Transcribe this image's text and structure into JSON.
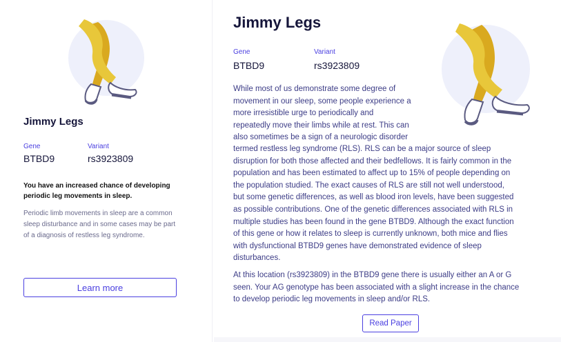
{
  "left_card": {
    "title": "Jimmy Legs",
    "gene_label": "Gene",
    "gene_value": "BTBD9",
    "variant_label": "Variant",
    "variant_value": "rs3923809",
    "result_text": "You have an increased chance of developing periodic leg movements in sleep.",
    "description": "Periodic limb movements in sleep are a common sleep disturbance and in some cases may be part of a diagnosis of restless leg syndrome.",
    "button_label": "Learn more"
  },
  "main": {
    "title": "Jimmy Legs",
    "gene_label": "Gene",
    "gene_value": "BTBD9",
    "variant_label": "Variant",
    "variant_value": "rs3923809",
    "paragraph1_lines": [
      "While most of us demonstrate some degree of",
      "movement in our sleep, some people experience a",
      "more irresistible urge to periodically and",
      "repeatedly move their limbs while at rest. This can",
      "also sometimes be a sign of a neurologic disorder",
      "termed restless leg syndrome (RLS). RLS can be a major source of sleep",
      "disruption for both those affected and their bedfellows. It is fairly common in the",
      "population and has been estimated to affect up to 15% of people depending on",
      "the population studied. The exact causes of RLS are still not well understood,",
      "but some genetic differences, as well as blood iron levels, have been suggested",
      "as possible contributions. One of the genetic differences associated with RLS in",
      "multiple studies has been found in the gene BTBD9. Although the exact function",
      "of this gene or how it relates to sleep is currently unknown, both mice and flies",
      "with dysfunctional BTBD9 genes have demonstrated evidence of sleep",
      "disturbances."
    ],
    "paragraph2_lines": [
      "At this location (rs3923809) in the BTBD9 gene there is usually either an A or G",
      "seen. Your AG genotype has been associated with a slight increase in the chance",
      "to develop periodic leg movements in sleep and/or RLS."
    ],
    "button_label": "Read Paper"
  },
  "colors": {
    "accent": "#4a3fe0",
    "body_text": "#3c3c86",
    "heading": "#15153a",
    "illustration_circle": "#eef0fb",
    "legs_yellow": "#e8c73a",
    "legs_dark_yellow": "#d9a91f"
  },
  "icons": {
    "left_illustration": "legs-illustration",
    "main_illustration": "legs-illustration"
  }
}
